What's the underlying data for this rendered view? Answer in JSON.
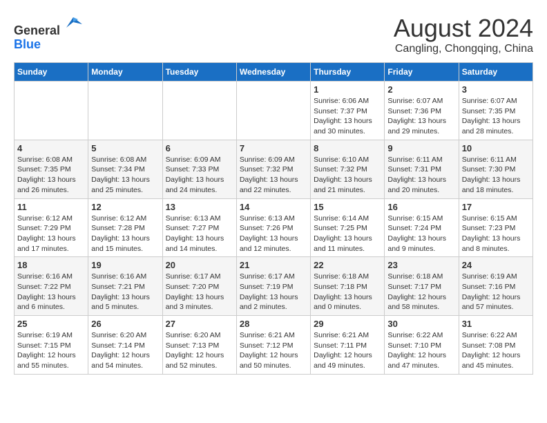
{
  "header": {
    "logo_line1": "General",
    "logo_line2": "Blue",
    "month": "August 2024",
    "location": "Cangling, Chongqing, China"
  },
  "weekdays": [
    "Sunday",
    "Monday",
    "Tuesday",
    "Wednesday",
    "Thursday",
    "Friday",
    "Saturday"
  ],
  "weeks": [
    [
      {
        "day": "",
        "info": ""
      },
      {
        "day": "",
        "info": ""
      },
      {
        "day": "",
        "info": ""
      },
      {
        "day": "",
        "info": ""
      },
      {
        "day": "1",
        "info": "Sunrise: 6:06 AM\nSunset: 7:37 PM\nDaylight: 13 hours\nand 30 minutes."
      },
      {
        "day": "2",
        "info": "Sunrise: 6:07 AM\nSunset: 7:36 PM\nDaylight: 13 hours\nand 29 minutes."
      },
      {
        "day": "3",
        "info": "Sunrise: 6:07 AM\nSunset: 7:35 PM\nDaylight: 13 hours\nand 28 minutes."
      }
    ],
    [
      {
        "day": "4",
        "info": "Sunrise: 6:08 AM\nSunset: 7:35 PM\nDaylight: 13 hours\nand 26 minutes."
      },
      {
        "day": "5",
        "info": "Sunrise: 6:08 AM\nSunset: 7:34 PM\nDaylight: 13 hours\nand 25 minutes."
      },
      {
        "day": "6",
        "info": "Sunrise: 6:09 AM\nSunset: 7:33 PM\nDaylight: 13 hours\nand 24 minutes."
      },
      {
        "day": "7",
        "info": "Sunrise: 6:09 AM\nSunset: 7:32 PM\nDaylight: 13 hours\nand 22 minutes."
      },
      {
        "day": "8",
        "info": "Sunrise: 6:10 AM\nSunset: 7:32 PM\nDaylight: 13 hours\nand 21 minutes."
      },
      {
        "day": "9",
        "info": "Sunrise: 6:11 AM\nSunset: 7:31 PM\nDaylight: 13 hours\nand 20 minutes."
      },
      {
        "day": "10",
        "info": "Sunrise: 6:11 AM\nSunset: 7:30 PM\nDaylight: 13 hours\nand 18 minutes."
      }
    ],
    [
      {
        "day": "11",
        "info": "Sunrise: 6:12 AM\nSunset: 7:29 PM\nDaylight: 13 hours\nand 17 minutes."
      },
      {
        "day": "12",
        "info": "Sunrise: 6:12 AM\nSunset: 7:28 PM\nDaylight: 13 hours\nand 15 minutes."
      },
      {
        "day": "13",
        "info": "Sunrise: 6:13 AM\nSunset: 7:27 PM\nDaylight: 13 hours\nand 14 minutes."
      },
      {
        "day": "14",
        "info": "Sunrise: 6:13 AM\nSunset: 7:26 PM\nDaylight: 13 hours\nand 12 minutes."
      },
      {
        "day": "15",
        "info": "Sunrise: 6:14 AM\nSunset: 7:25 PM\nDaylight: 13 hours\nand 11 minutes."
      },
      {
        "day": "16",
        "info": "Sunrise: 6:15 AM\nSunset: 7:24 PM\nDaylight: 13 hours\nand 9 minutes."
      },
      {
        "day": "17",
        "info": "Sunrise: 6:15 AM\nSunset: 7:23 PM\nDaylight: 13 hours\nand 8 minutes."
      }
    ],
    [
      {
        "day": "18",
        "info": "Sunrise: 6:16 AM\nSunset: 7:22 PM\nDaylight: 13 hours\nand 6 minutes."
      },
      {
        "day": "19",
        "info": "Sunrise: 6:16 AM\nSunset: 7:21 PM\nDaylight: 13 hours\nand 5 minutes."
      },
      {
        "day": "20",
        "info": "Sunrise: 6:17 AM\nSunset: 7:20 PM\nDaylight: 13 hours\nand 3 minutes."
      },
      {
        "day": "21",
        "info": "Sunrise: 6:17 AM\nSunset: 7:19 PM\nDaylight: 13 hours\nand 2 minutes."
      },
      {
        "day": "22",
        "info": "Sunrise: 6:18 AM\nSunset: 7:18 PM\nDaylight: 13 hours\nand 0 minutes."
      },
      {
        "day": "23",
        "info": "Sunrise: 6:18 AM\nSunset: 7:17 PM\nDaylight: 12 hours\nand 58 minutes."
      },
      {
        "day": "24",
        "info": "Sunrise: 6:19 AM\nSunset: 7:16 PM\nDaylight: 12 hours\nand 57 minutes."
      }
    ],
    [
      {
        "day": "25",
        "info": "Sunrise: 6:19 AM\nSunset: 7:15 PM\nDaylight: 12 hours\nand 55 minutes."
      },
      {
        "day": "26",
        "info": "Sunrise: 6:20 AM\nSunset: 7:14 PM\nDaylight: 12 hours\nand 54 minutes."
      },
      {
        "day": "27",
        "info": "Sunrise: 6:20 AM\nSunset: 7:13 PM\nDaylight: 12 hours\nand 52 minutes."
      },
      {
        "day": "28",
        "info": "Sunrise: 6:21 AM\nSunset: 7:12 PM\nDaylight: 12 hours\nand 50 minutes."
      },
      {
        "day": "29",
        "info": "Sunrise: 6:21 AM\nSunset: 7:11 PM\nDaylight: 12 hours\nand 49 minutes."
      },
      {
        "day": "30",
        "info": "Sunrise: 6:22 AM\nSunset: 7:10 PM\nDaylight: 12 hours\nand 47 minutes."
      },
      {
        "day": "31",
        "info": "Sunrise: 6:22 AM\nSunset: 7:08 PM\nDaylight: 12 hours\nand 45 minutes."
      }
    ]
  ]
}
